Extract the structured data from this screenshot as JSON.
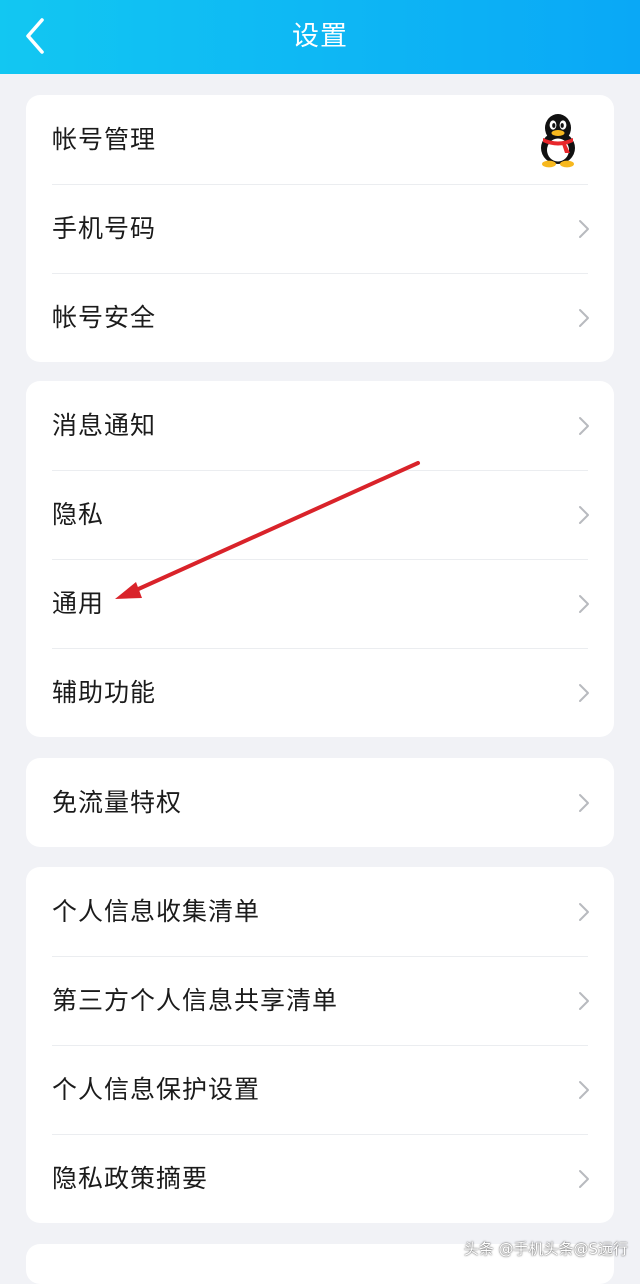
{
  "header": {
    "title": "设置",
    "back_icon": "chevron-left-icon",
    "background": "#0aa8f6"
  },
  "groups": [
    {
      "items": [
        {
          "label": "帐号管理",
          "trailing": "qq-penguin-avatar-icon"
        },
        {
          "label": "手机号码",
          "trailing": "chevron-right-icon"
        },
        {
          "label": "帐号安全",
          "trailing": "chevron-right-icon"
        }
      ]
    },
    {
      "items": [
        {
          "label": "消息通知",
          "trailing": "chevron-right-icon"
        },
        {
          "label": "隐私",
          "trailing": "chevron-right-icon"
        },
        {
          "label": "通用",
          "trailing": "chevron-right-icon"
        },
        {
          "label": "辅助功能",
          "trailing": "chevron-right-icon"
        }
      ]
    },
    {
      "items": [
        {
          "label": "免流量特权",
          "trailing": "chevron-right-icon"
        }
      ]
    },
    {
      "items": [
        {
          "label": "个人信息收集清单",
          "trailing": "chevron-right-icon"
        },
        {
          "label": "第三方个人信息共享清单",
          "trailing": "chevron-right-icon"
        },
        {
          "label": "个人信息保护设置",
          "trailing": "chevron-right-icon"
        },
        {
          "label": "隐私政策摘要",
          "trailing": "chevron-right-icon"
        }
      ]
    }
  ],
  "annotation": {
    "type": "red-arrow",
    "points_to": "通用",
    "color": "#d9232a"
  },
  "watermark": {
    "text": "头条 @手机头条@S远行"
  }
}
